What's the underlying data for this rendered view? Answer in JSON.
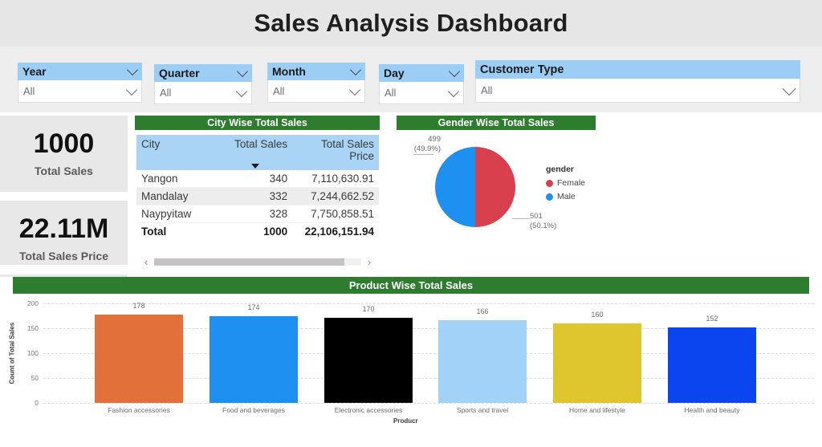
{
  "header": {
    "title": "Sales Analysis Dashboard",
    "background_color": "#e6e6e6"
  },
  "slicers": {
    "placeholder_value": "All",
    "header_color": "#9ccdf5",
    "items": [
      {
        "label": "Year",
        "value": "All",
        "chevron": "chevron-down-icon"
      },
      {
        "label": "Quarter",
        "value": "All",
        "chevron": "chevron-down-icon"
      },
      {
        "label": "Month",
        "value": "All",
        "chevron": "chevron-down-icon"
      },
      {
        "label": "Day",
        "value": "All",
        "chevron": "chevron-down-icon"
      },
      {
        "label": "Customer Type",
        "value": "All",
        "chevron": "chevron-down-icon"
      }
    ]
  },
  "kpis": [
    {
      "value": "1000",
      "caption": "Total Sales"
    },
    {
      "value": "22.11M",
      "caption": "Total Sales Price"
    }
  ],
  "city_table": {
    "title": "City Wise Total Sales",
    "title_color": "#2e7d2e",
    "columns": [
      "City",
      "Total Sales",
      "Total Sales Price"
    ],
    "sorted_column": "Total Sales",
    "rows": [
      {
        "city": "Yangon",
        "total_sales": "340",
        "total_sales_price": "7,110,630.91"
      },
      {
        "city": "Mandalay",
        "total_sales": "332",
        "total_sales_price": "7,244,662.52"
      },
      {
        "city": "Naypyitaw",
        "total_sales": "328",
        "total_sales_price": "7,750,858.51"
      }
    ],
    "total_row": {
      "city": "Total",
      "total_sales": "1000",
      "total_sales_price": "22,106,151.94"
    },
    "scroll_left": "‹",
    "scroll_right": "›"
  },
  "gender_chart": {
    "title": "Gender Wise Total Sales",
    "title_color": "#2e7d2e",
    "legend_title": "gender",
    "label_male": "499",
    "label_male_pct": "(49.9%)",
    "label_female": "501",
    "label_female_pct": "(50.1%)"
  },
  "product_chart": {
    "title": "Product Wise Total Sales",
    "title_color": "#2e7d2e"
  },
  "chart_data": [
    {
      "type": "pie",
      "title": "Gender Wise Total Sales",
      "legend_title": "gender",
      "legend_position": "right",
      "labels": [
        "Female",
        "Male"
      ],
      "values": [
        501,
        499
      ],
      "percentages": [
        "50.1%",
        "49.9%"
      ],
      "colors": [
        "#d9404e",
        "#1e90f2"
      ],
      "total": 1000
    },
    {
      "type": "bar",
      "title": "Product Wise Total Sales",
      "categories": [
        "Fashion accessories",
        "Food and beverages",
        "Electronic accessories",
        "Sports and travel",
        "Home and lifestyle",
        "Health and beauty"
      ],
      "values": [
        178,
        174,
        170,
        166,
        160,
        152
      ],
      "colors": [
        "#e2703a",
        "#1e90f2",
        "#000000",
        "#a3d2f9",
        "#dfc62e",
        "#0b45ef"
      ],
      "xlabel": "Producr",
      "ylabel": "Count of Total Sales",
      "ylim": [
        0,
        200
      ],
      "yticks": [
        "0",
        "50",
        "100",
        "150",
        "200"
      ],
      "grid": true,
      "legend": false
    }
  ]
}
